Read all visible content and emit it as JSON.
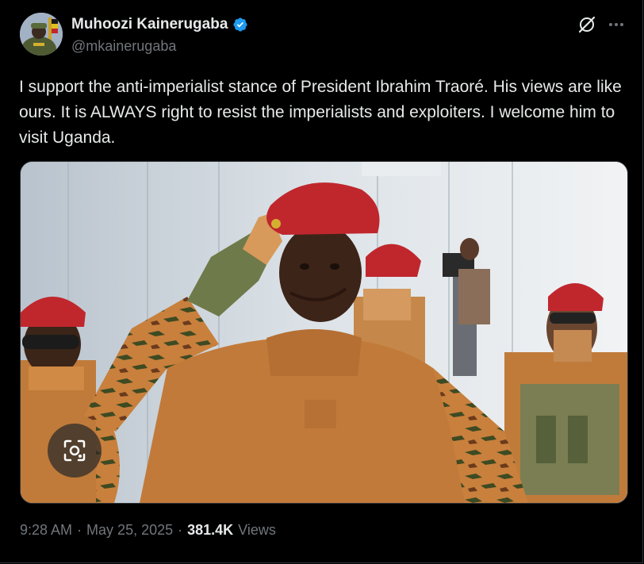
{
  "author": {
    "display_name": "Muhoozi Kainerugaba",
    "handle": "@mkainerugaba",
    "verified": true
  },
  "tweet": {
    "text": "I support the anti-imperialist stance of President Ibrahim Traoré. His views are like ours. It is ALWAYS right to resist the imperialists and exploiters. I welcome him to visit Uganda."
  },
  "meta": {
    "time": "9:28 AM",
    "separator1": "·",
    "date": "May 25, 2025",
    "separator2": "·",
    "views_count": "381.4K",
    "views_label": "Views"
  },
  "icons": {
    "verified": "verified-badge-icon",
    "grok": "grok-icon",
    "more": "more-dots-icon",
    "lens": "visual-search-icon"
  },
  "colors": {
    "background": "#000000",
    "text": "#e7e9ea",
    "secondary": "#71767b",
    "verified": "#1d9bf0",
    "beret": "#c0272d"
  }
}
